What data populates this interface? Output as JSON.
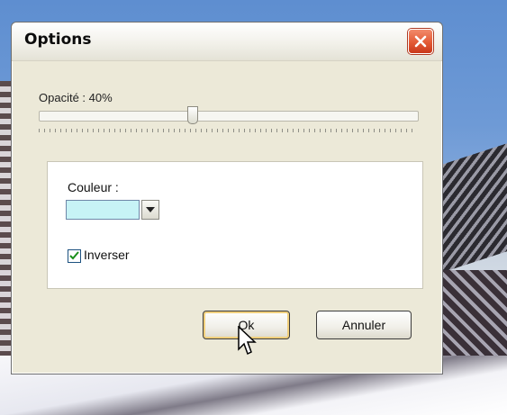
{
  "dialog": {
    "title": "Options",
    "close_icon": "close-x-icon",
    "opacity": {
      "label": "Opacité : 40%",
      "value_fraction": 0.4
    },
    "color_group": {
      "label": "Couleur :",
      "selected_color": "#c7f3f6",
      "dropdown_icon": "chevron-down-icon"
    },
    "invert": {
      "label": "Inverser",
      "checked": true
    },
    "buttons": {
      "ok": "Ok",
      "cancel": "Annuler"
    }
  },
  "colors": {
    "dialog_bg": "#ece9d8",
    "close_button": "#e35a35",
    "ok_focus": "#f0cf7c"
  }
}
